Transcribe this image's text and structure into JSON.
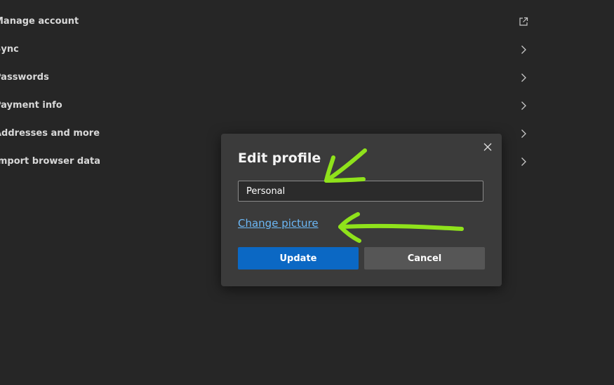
{
  "settings": {
    "items": [
      {
        "label": "Manage account",
        "icon": "external-link-icon"
      },
      {
        "label": "Sync",
        "icon": "chevron-right-icon"
      },
      {
        "label": "Passwords",
        "icon": "chevron-right-icon"
      },
      {
        "label": "Payment info",
        "icon": "chevron-right-icon"
      },
      {
        "label": "Addresses and more",
        "icon": "chevron-right-icon"
      },
      {
        "label": "Import browser data",
        "icon": "chevron-right-icon"
      }
    ]
  },
  "dialog": {
    "title": "Edit profile",
    "name_value": "Personal",
    "change_picture_label": "Change picture",
    "update_label": "Update",
    "cancel_label": "Cancel",
    "close_icon": "close-icon"
  },
  "colors": {
    "background": "#262626",
    "dialog_background": "#3b3b3b",
    "primary_button": "#0b68c4",
    "secondary_button": "#565656",
    "link": "#6cb8f6",
    "annotation_arrow": "#8fe21b"
  }
}
